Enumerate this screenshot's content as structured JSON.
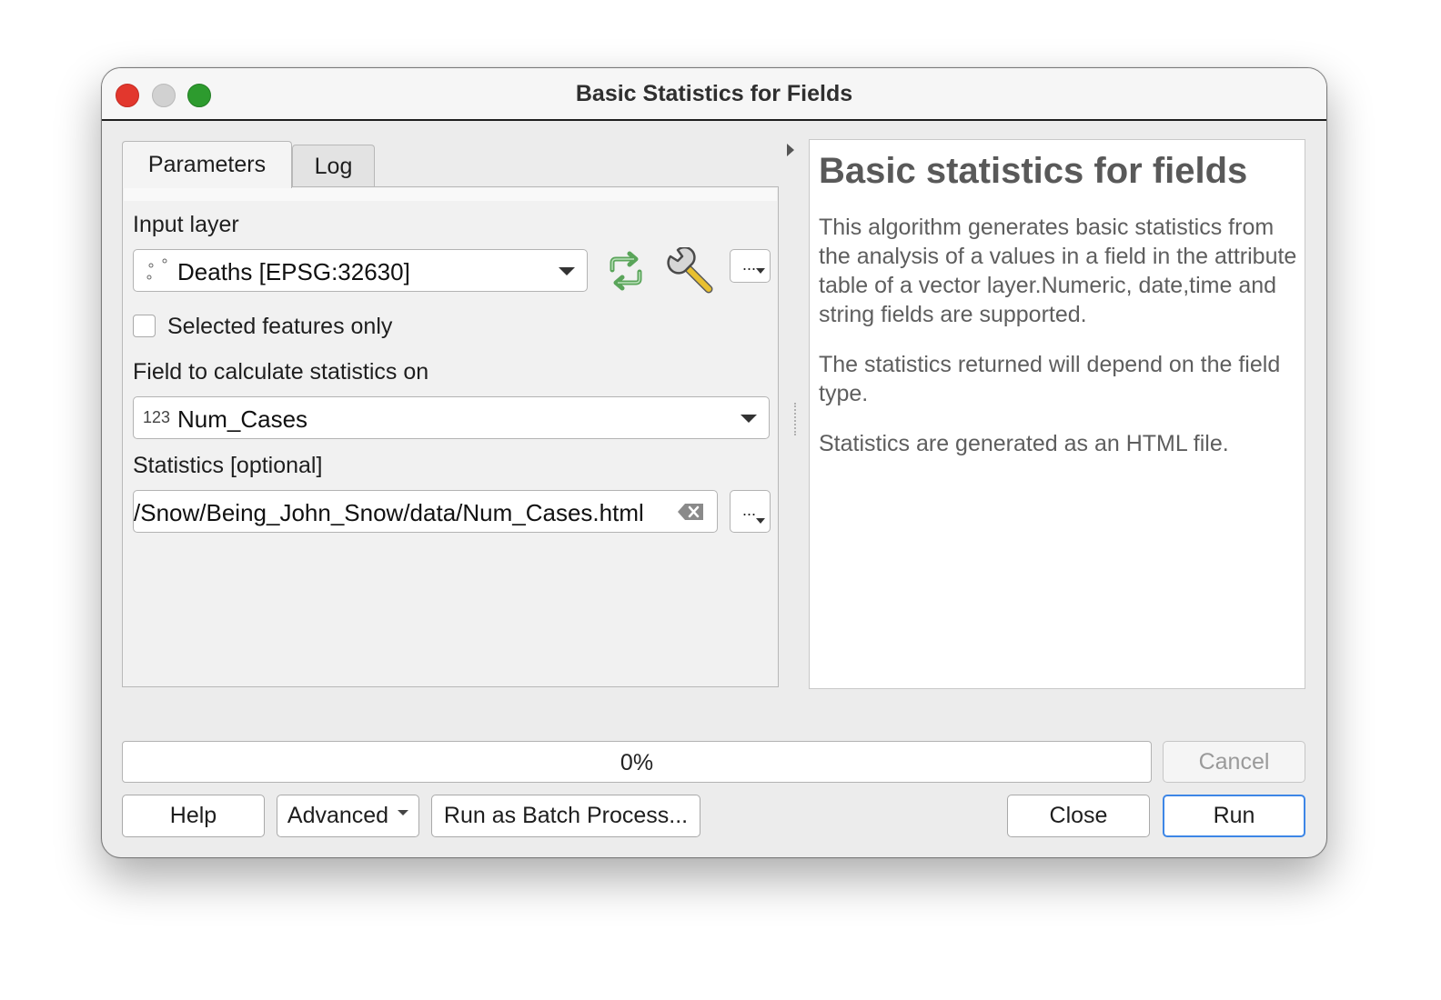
{
  "window": {
    "title": "Basic Statistics for Fields"
  },
  "tabs": [
    {
      "label": "Parameters",
      "active": true
    },
    {
      "label": "Log",
      "active": false
    }
  ],
  "params": {
    "input_layer_label": "Input layer",
    "input_layer_value": "Deaths [EPSG:32630]",
    "dots_label": "...",
    "selected_only_label": "Selected features only",
    "selected_only_checked": false,
    "field_label": "Field to calculate statistics on",
    "field_type_badge": "123",
    "field_value": "Num_Cases",
    "statistics_label": "Statistics [optional]",
    "statistics_value": "/Snow/Being_John_Snow/data/Num_Cases.html"
  },
  "help": {
    "title": "Basic statistics for fields",
    "paragraphs": [
      "This algorithm generates basic statistics from the analysis of a values in a field in the attribute table of a vector layer.Numeric, date,time and string fields are supported.",
      "The statistics returned will depend on the field type.",
      "Statistics are generated as an HTML file."
    ]
  },
  "progress": {
    "value_percent": 0,
    "text": "0%"
  },
  "buttons": {
    "cancel": "Cancel",
    "help": "Help",
    "advanced": "Advanced",
    "batch": "Run as Batch Process...",
    "close": "Close",
    "run": "Run"
  },
  "colors": {
    "accent": "#3d86e6",
    "traffic_close": "#e2372d",
    "traffic_min": "#d1d1d1",
    "traffic_max": "#2d9b2e",
    "refresh_icon": "#5aa55a"
  }
}
